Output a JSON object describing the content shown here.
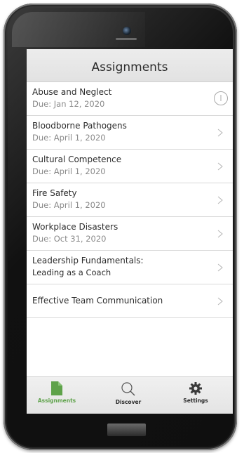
{
  "header": {
    "title": "Assignments"
  },
  "assignments": [
    {
      "title": "Abuse and Neglect",
      "subtitle": "Due: Jan 12, 2020",
      "trailing_icon": "info-icon"
    },
    {
      "title": "Bloodborne Pathogens",
      "subtitle": "Due: April 1, 2020",
      "trailing_icon": "chevron-right-icon"
    },
    {
      "title": "Cultural Competence",
      "subtitle": "Due: April 1, 2020",
      "trailing_icon": "chevron-right-icon"
    },
    {
      "title": "Fire Safety",
      "subtitle": "Due: April 1, 2020",
      "trailing_icon": "chevron-right-icon"
    },
    {
      "title": "Workplace Disasters",
      "subtitle": "Due: Oct 31, 2020",
      "trailing_icon": "chevron-right-icon"
    },
    {
      "title": "Leadership Fundamentals:",
      "title_line2": "Leading as a Coach",
      "trailing_icon": "chevron-right-icon"
    },
    {
      "title": "Effective Team Communication",
      "trailing_icon": "chevron-right-icon"
    }
  ],
  "tabbar": {
    "tabs": [
      {
        "label": "Assignments",
        "icon": "document-icon",
        "active": true
      },
      {
        "label": "Discover",
        "icon": "search-icon",
        "active": false
      },
      {
        "label": "Settings",
        "icon": "gear-icon",
        "active": false
      }
    ]
  },
  "colors": {
    "active_tab": "#5ea24a",
    "text_primary": "#2d2d2d",
    "text_secondary": "#8a8a8a",
    "divider": "#d8d8d8"
  }
}
